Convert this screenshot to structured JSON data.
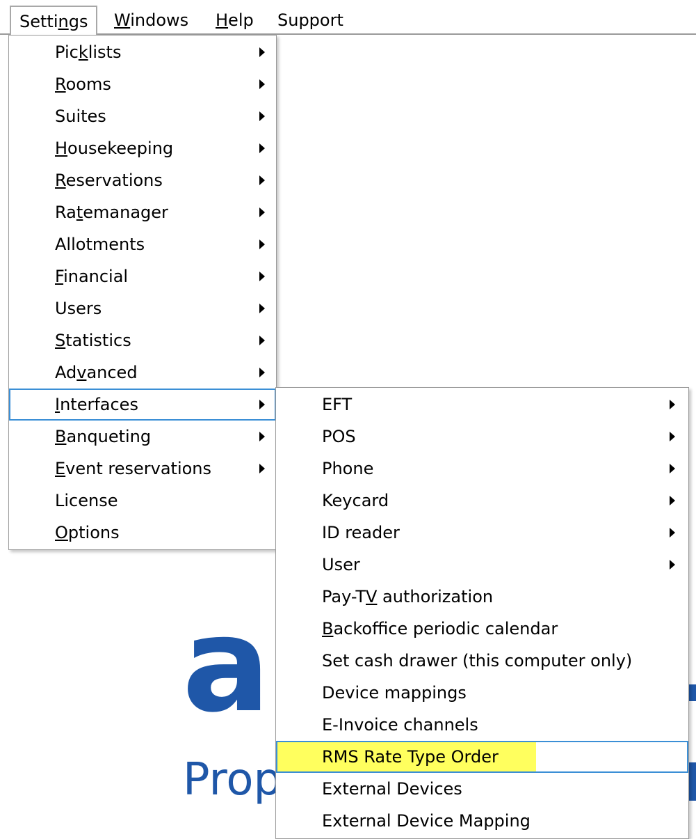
{
  "menubar": {
    "items": [
      {
        "pre": "Setti",
        "ul": "n",
        "post": "gs"
      },
      {
        "pre": "",
        "ul": "W",
        "post": "indows"
      },
      {
        "pre": "",
        "ul": "H",
        "post": "elp"
      },
      {
        "pre": "Support",
        "ul": "",
        "post": ""
      }
    ]
  },
  "settings_menu": {
    "items": [
      {
        "pre": "Pic",
        "ul": "k",
        "post": "lists",
        "submenu": true
      },
      {
        "pre": "",
        "ul": "R",
        "post": "ooms",
        "submenu": true
      },
      {
        "pre": "Suites",
        "ul": "",
        "post": "",
        "submenu": true
      },
      {
        "pre": "",
        "ul": "H",
        "post": "ousekeeping",
        "submenu": true
      },
      {
        "pre": "",
        "ul": "R",
        "post": "eservations",
        "submenu": true
      },
      {
        "pre": "Ra",
        "ul": "t",
        "post": "emanager",
        "submenu": true
      },
      {
        "pre": "Allotments",
        "ul": "",
        "post": "",
        "submenu": true
      },
      {
        "pre": "",
        "ul": "F",
        "post": "inancial",
        "submenu": true
      },
      {
        "pre": "Users",
        "ul": "",
        "post": "",
        "submenu": true
      },
      {
        "pre": "",
        "ul": "S",
        "post": "tatistics",
        "submenu": true
      },
      {
        "pre": "Ad",
        "ul": "v",
        "post": "anced",
        "submenu": true
      },
      {
        "pre": "",
        "ul": "I",
        "post": "nterfaces",
        "submenu": true
      },
      {
        "pre": "",
        "ul": "B",
        "post": "anqueting",
        "submenu": true
      },
      {
        "pre": "",
        "ul": "E",
        "post": "vent reservations",
        "submenu": true
      },
      {
        "pre": "License",
        "ul": "",
        "post": "",
        "submenu": false
      },
      {
        "pre": "",
        "ul": "O",
        "post": "ptions",
        "submenu": false
      }
    ]
  },
  "interfaces_menu": {
    "items": [
      {
        "pre": "EFT",
        "ul": "",
        "post": "",
        "submenu": true
      },
      {
        "pre": "POS",
        "ul": "",
        "post": "",
        "submenu": true
      },
      {
        "pre": "Phone",
        "ul": "",
        "post": "",
        "submenu": true
      },
      {
        "pre": "Keycard",
        "ul": "",
        "post": "",
        "submenu": true
      },
      {
        "pre": "ID reader",
        "ul": "",
        "post": "",
        "submenu": true
      },
      {
        "pre": "User",
        "ul": "",
        "post": "",
        "submenu": true
      },
      {
        "pre": "Pay-T",
        "ul": "V",
        "post": " authorization",
        "submenu": false
      },
      {
        "pre": "",
        "ul": "B",
        "post": "ackoffice periodic calendar",
        "submenu": false
      },
      {
        "pre": "Set cash drawer (this computer only)",
        "ul": "",
        "post": "",
        "submenu": false
      },
      {
        "pre": "Device mappings",
        "ul": "",
        "post": "",
        "submenu": false
      },
      {
        "pre": "E-Invoice channels",
        "ul": "",
        "post": "",
        "submenu": false
      },
      {
        "pre": "RMS Rate Type Order",
        "ul": "",
        "post": "",
        "submenu": false
      },
      {
        "pre": "External Devices",
        "ul": "",
        "post": "",
        "submenu": false
      },
      {
        "pre": "External Device Mapping",
        "ul": "",
        "post": "",
        "submenu": false
      }
    ]
  },
  "brand": {
    "logo_letter": "a",
    "tagline_fragment": "Prop"
  },
  "colors": {
    "brand_blue": "#1f57a8",
    "highlight_outline": "#3b8fd6",
    "marker_yellow": "#ffff4d"
  }
}
